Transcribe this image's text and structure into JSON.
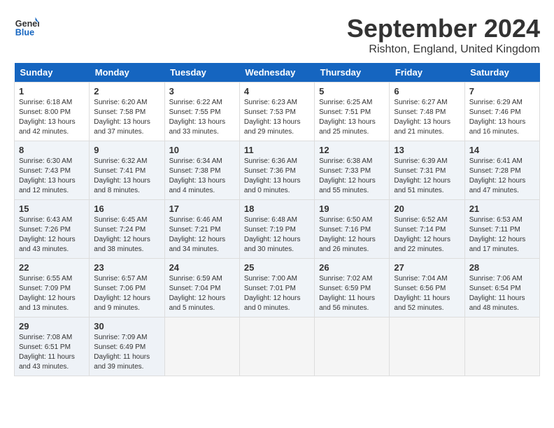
{
  "header": {
    "logo_line1": "General",
    "logo_line2": "Blue",
    "month": "September 2024",
    "location": "Rishton, England, United Kingdom"
  },
  "columns": [
    "Sunday",
    "Monday",
    "Tuesday",
    "Wednesday",
    "Thursday",
    "Friday",
    "Saturday"
  ],
  "weeks": [
    [
      {
        "day": "1",
        "info": "Sunrise: 6:18 AM\nSunset: 8:00 PM\nDaylight: 13 hours\nand 42 minutes."
      },
      {
        "day": "2",
        "info": "Sunrise: 6:20 AM\nSunset: 7:58 PM\nDaylight: 13 hours\nand 37 minutes."
      },
      {
        "day": "3",
        "info": "Sunrise: 6:22 AM\nSunset: 7:55 PM\nDaylight: 13 hours\nand 33 minutes."
      },
      {
        "day": "4",
        "info": "Sunrise: 6:23 AM\nSunset: 7:53 PM\nDaylight: 13 hours\nand 29 minutes."
      },
      {
        "day": "5",
        "info": "Sunrise: 6:25 AM\nSunset: 7:51 PM\nDaylight: 13 hours\nand 25 minutes."
      },
      {
        "day": "6",
        "info": "Sunrise: 6:27 AM\nSunset: 7:48 PM\nDaylight: 13 hours\nand 21 minutes."
      },
      {
        "day": "7",
        "info": "Sunrise: 6:29 AM\nSunset: 7:46 PM\nDaylight: 13 hours\nand 16 minutes."
      }
    ],
    [
      {
        "day": "8",
        "info": "Sunrise: 6:30 AM\nSunset: 7:43 PM\nDaylight: 13 hours\nand 12 minutes."
      },
      {
        "day": "9",
        "info": "Sunrise: 6:32 AM\nSunset: 7:41 PM\nDaylight: 13 hours\nand 8 minutes."
      },
      {
        "day": "10",
        "info": "Sunrise: 6:34 AM\nSunset: 7:38 PM\nDaylight: 13 hours\nand 4 minutes."
      },
      {
        "day": "11",
        "info": "Sunrise: 6:36 AM\nSunset: 7:36 PM\nDaylight: 13 hours\nand 0 minutes."
      },
      {
        "day": "12",
        "info": "Sunrise: 6:38 AM\nSunset: 7:33 PM\nDaylight: 12 hours\nand 55 minutes."
      },
      {
        "day": "13",
        "info": "Sunrise: 6:39 AM\nSunset: 7:31 PM\nDaylight: 12 hours\nand 51 minutes."
      },
      {
        "day": "14",
        "info": "Sunrise: 6:41 AM\nSunset: 7:28 PM\nDaylight: 12 hours\nand 47 minutes."
      }
    ],
    [
      {
        "day": "15",
        "info": "Sunrise: 6:43 AM\nSunset: 7:26 PM\nDaylight: 12 hours\nand 43 minutes."
      },
      {
        "day": "16",
        "info": "Sunrise: 6:45 AM\nSunset: 7:24 PM\nDaylight: 12 hours\nand 38 minutes."
      },
      {
        "day": "17",
        "info": "Sunrise: 6:46 AM\nSunset: 7:21 PM\nDaylight: 12 hours\nand 34 minutes."
      },
      {
        "day": "18",
        "info": "Sunrise: 6:48 AM\nSunset: 7:19 PM\nDaylight: 12 hours\nand 30 minutes."
      },
      {
        "day": "19",
        "info": "Sunrise: 6:50 AM\nSunset: 7:16 PM\nDaylight: 12 hours\nand 26 minutes."
      },
      {
        "day": "20",
        "info": "Sunrise: 6:52 AM\nSunset: 7:14 PM\nDaylight: 12 hours\nand 22 minutes."
      },
      {
        "day": "21",
        "info": "Sunrise: 6:53 AM\nSunset: 7:11 PM\nDaylight: 12 hours\nand 17 minutes."
      }
    ],
    [
      {
        "day": "22",
        "info": "Sunrise: 6:55 AM\nSunset: 7:09 PM\nDaylight: 12 hours\nand 13 minutes."
      },
      {
        "day": "23",
        "info": "Sunrise: 6:57 AM\nSunset: 7:06 PM\nDaylight: 12 hours\nand 9 minutes."
      },
      {
        "day": "24",
        "info": "Sunrise: 6:59 AM\nSunset: 7:04 PM\nDaylight: 12 hours\nand 5 minutes."
      },
      {
        "day": "25",
        "info": "Sunrise: 7:00 AM\nSunset: 7:01 PM\nDaylight: 12 hours\nand 0 minutes."
      },
      {
        "day": "26",
        "info": "Sunrise: 7:02 AM\nSunset: 6:59 PM\nDaylight: 11 hours\nand 56 minutes."
      },
      {
        "day": "27",
        "info": "Sunrise: 7:04 AM\nSunset: 6:56 PM\nDaylight: 11 hours\nand 52 minutes."
      },
      {
        "day": "28",
        "info": "Sunrise: 7:06 AM\nSunset: 6:54 PM\nDaylight: 11 hours\nand 48 minutes."
      }
    ],
    [
      {
        "day": "29",
        "info": "Sunrise: 7:08 AM\nSunset: 6:51 PM\nDaylight: 11 hours\nand 43 minutes."
      },
      {
        "day": "30",
        "info": "Sunrise: 7:09 AM\nSunset: 6:49 PM\nDaylight: 11 hours\nand 39 minutes."
      },
      null,
      null,
      null,
      null,
      null
    ]
  ]
}
